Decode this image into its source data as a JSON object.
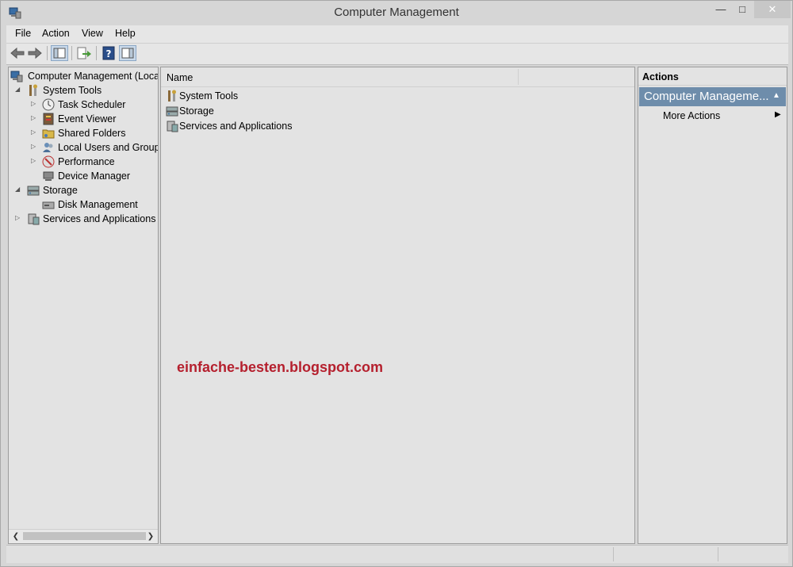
{
  "window": {
    "title": "Computer Management"
  },
  "menubar": {
    "items": [
      "File",
      "Action",
      "View",
      "Help"
    ]
  },
  "toolbar": {
    "buttons": [
      "back-icon",
      "forward-icon",
      "show-hide-tree-icon",
      "export-list-icon",
      "help-icon",
      "show-hide-action-pane-icon"
    ]
  },
  "tree": {
    "root": "Computer Management (Local",
    "system_tools": "System Tools",
    "task_scheduler": "Task Scheduler",
    "event_viewer": "Event Viewer",
    "shared_folders": "Shared Folders",
    "local_users": "Local Users and Groups",
    "performance": "Performance",
    "device_manager": "Device Manager",
    "storage": "Storage",
    "disk_management": "Disk Management",
    "services": "Services and Applications"
  },
  "list": {
    "column_name": "Name",
    "items": [
      "System Tools",
      "Storage",
      "Services and Applications"
    ]
  },
  "watermark": "einfache-besten.blogspot.com",
  "actions": {
    "header": "Actions",
    "section": "Computer Manageme...",
    "more_actions": "More Actions"
  },
  "colors": {
    "selection": "#6e8dab",
    "watermark": "#b5202e"
  }
}
